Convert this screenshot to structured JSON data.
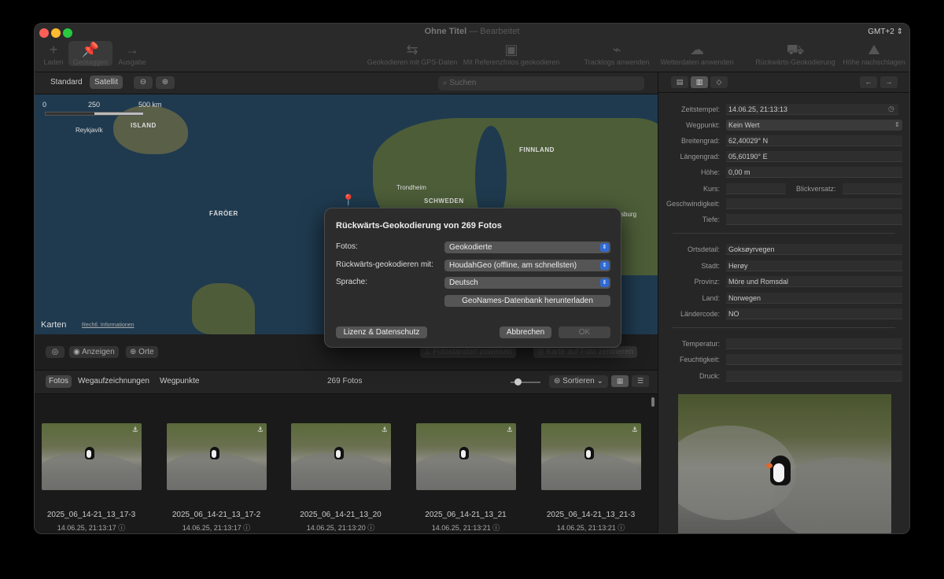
{
  "window": {
    "title": "Ohne Titel",
    "title_sep": "—",
    "subtitle": "Bearbeitet",
    "timezone": "GMT+2 ⇕"
  },
  "toolbar": {
    "items": [
      {
        "label": "Laden",
        "icon": "plus-icon",
        "glyph": "+"
      },
      {
        "label": "Geotaggen",
        "icon": "pin-icon",
        "glyph": "📌"
      },
      {
        "label": "Ausgabe",
        "icon": "arrow-right-icon",
        "glyph": "→"
      }
    ],
    "actions": [
      {
        "label": "Geokodieren mit GPS-Daten",
        "glyph": "⇆"
      },
      {
        "label": "Mit Referenzfotos geokodieren",
        "glyph": "▣"
      },
      {
        "label": "Tracklogs anwenden",
        "glyph": "⌁"
      },
      {
        "label": "Wetterdaten anwenden",
        "glyph": "☁"
      },
      {
        "label": "Rückwärts-Geokodierung",
        "glyph": "⛟"
      },
      {
        "label": "Höhe nachschlagen",
        "glyph": "⛰"
      }
    ]
  },
  "map": {
    "mode_standard": "Standard",
    "mode_satellite": "Satellit",
    "zoom_out": "⊖",
    "zoom_in": "⊕",
    "search_placeholder": "Suchen",
    "scale_0": "0",
    "scale_250": "250",
    "scale_500": "500 km",
    "labels": {
      "reykjavik": "Reykjavík",
      "island": "ISLAND",
      "finnland": "FINNLAND",
      "trondheim": "Trondheim",
      "schweden": "SCHWEDEN",
      "faroer": "FÄRÖER",
      "burg": "sburg"
    },
    "brand": " Karten",
    "legal": "Rechtl. Informationen",
    "foot": {
      "target_label": "◎",
      "show_label": "Anzeigen",
      "places_label": "Orte",
      "assign_location": "Fotostandort zuweisen",
      "center_on_photo": "Karte auf Foto zentrieren"
    }
  },
  "grid": {
    "tabs": [
      "Fotos",
      "Wegaufzeichnungen",
      "Wegpunkte"
    ],
    "count": "269 Fotos",
    "sort_label": "Sortieren",
    "photos": [
      {
        "name": "2025_06_14-21_13_17-3",
        "date": "14.06.25, 21:13:17"
      },
      {
        "name": "2025_06_14-21_13_17-2",
        "date": "14.06.25, 21:13:17"
      },
      {
        "name": "2025_06_14-21_13_20",
        "date": "14.06.25, 21:13:20"
      },
      {
        "name": "2025_06_14-21_13_21",
        "date": "14.06.25, 21:13:21"
      },
      {
        "name": "2025_06_14-21_13_21-3",
        "date": "14.06.25, 21:13:21"
      }
    ]
  },
  "inspector": {
    "fields": [
      {
        "label": "Zeitstempel:",
        "value": "14.06.25, 21:13:13"
      },
      {
        "label": "Wegpunkt:",
        "value": "Kein Wert"
      },
      {
        "label": "Breitengrad:",
        "value": "62,40029° N"
      },
      {
        "label": "Längengrad:",
        "value": "05,60190° E"
      },
      {
        "label": "Höhe:",
        "value": "0,00 m"
      },
      {
        "label": "Kurs:",
        "value": ""
      },
      {
        "label": "Geschwindigkeit:",
        "value": ""
      },
      {
        "label": "Tiefe:",
        "value": ""
      }
    ],
    "blickversatz_label": "Blickversatz:",
    "location_fields": [
      {
        "label": "Ortsdetail:",
        "value": "Goksøyrvegen"
      },
      {
        "label": "Stadt:",
        "value": "Herøy"
      },
      {
        "label": "Provinz:",
        "value": "Möre und Romsdal"
      },
      {
        "label": "Land:",
        "value": "Norwegen"
      },
      {
        "label": "Ländercode:",
        "value": "NO"
      }
    ],
    "weather_fields": [
      {
        "label": "Temperatur:",
        "value": ""
      },
      {
        "label": "Feuchtigkeit:",
        "value": ""
      },
      {
        "label": "Druck:",
        "value": ""
      }
    ]
  },
  "dialog": {
    "title": "Rückwärts-Geokodierung von 269 Fotos",
    "photos_label": "Fotos:",
    "photos_value": "Geokodierte",
    "geocoder_label": "Rückwärts-geokodieren mit:",
    "geocoder_value": "HoudahGeo (offline, am schnellsten)",
    "language_label": "Sprache:",
    "language_value": "Deutsch",
    "download_button": "GeoNames-Datenbank herunterladen",
    "license_button": "Lizenz & Datenschutz",
    "cancel_button": "Abbrechen",
    "ok_button": "OK"
  }
}
